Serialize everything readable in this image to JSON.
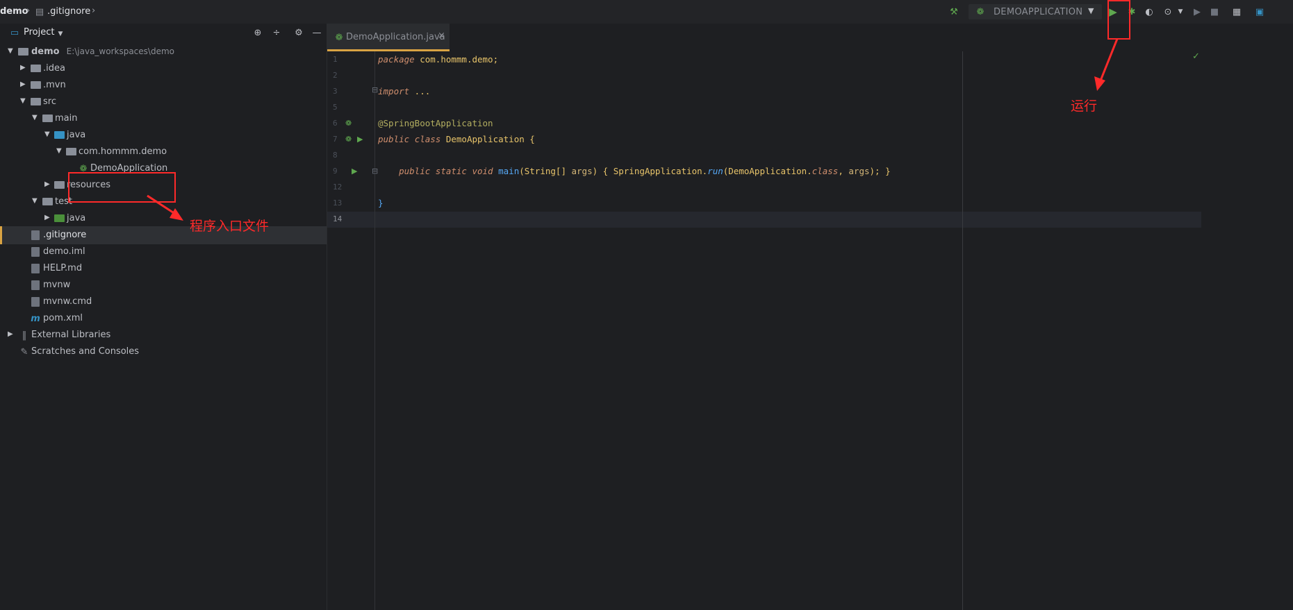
{
  "breadcrumb": {
    "project": "demo",
    "file": ".gitignore"
  },
  "toolbar": {
    "run_config": "DEMOAPPLICATION"
  },
  "project_panel": {
    "title": "Project",
    "root": {
      "name": "demo",
      "path": "E:\\java_workspaces\\demo"
    },
    "items": [
      {
        "label": ".idea"
      },
      {
        "label": ".mvn"
      },
      {
        "label": "src"
      },
      {
        "label": "main"
      },
      {
        "label": "java"
      },
      {
        "label": "com.hommm.demo"
      },
      {
        "label": "DemoApplication"
      },
      {
        "label": "resources"
      },
      {
        "label": "test"
      },
      {
        "label": "java"
      },
      {
        "label": ".gitignore"
      },
      {
        "label": "demo.iml"
      },
      {
        "label": "HELP.md"
      },
      {
        "label": "mvnw"
      },
      {
        "label": "mvnw.cmd"
      },
      {
        "label": "pom.xml"
      },
      {
        "label": "External Libraries"
      },
      {
        "label": "Scratches and Consoles"
      }
    ]
  },
  "editor": {
    "tab": "DemoApplication.java",
    "line_numbers": [
      "1",
      "2",
      "3",
      "5",
      "6",
      "7",
      "8",
      "9",
      "12",
      "13",
      "14"
    ],
    "code": {
      "l1_kw": "package",
      "l1_rest": " com.hommm.demo;",
      "l3_kw": "import",
      "l3_rest": " ...",
      "l6": "@SpringBootApplication",
      "l7_kw1": "public",
      "l7_kw2": "class",
      "l7_cls": "DemoApplication",
      "l7_rest": " {",
      "l9_kw1": "public",
      "l9_kw2": "static",
      "l9_kw3": "void",
      "l9_fn": "main",
      "l9_a": "(String[] ",
      "l9_param": "args",
      "l9_b": ") { SpringApplication.",
      "l9_run": "run",
      "l9_c": "(DemoApplication.",
      "l9_kw4": "class",
      "l9_d": ", ",
      "l9_param2": "args",
      "l9_e": "); }",
      "l13": "}"
    }
  },
  "annotations": {
    "entry_file": "程序入口文件",
    "run": "运行"
  }
}
